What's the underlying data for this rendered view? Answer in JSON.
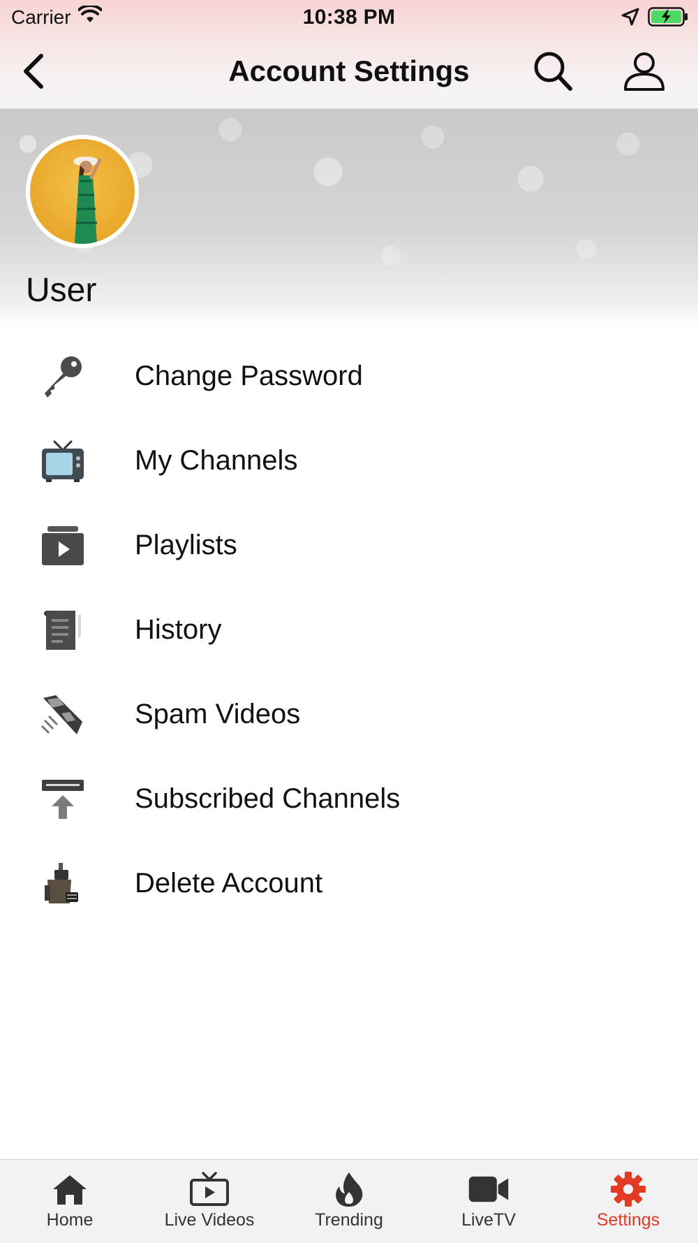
{
  "status_bar": {
    "carrier": "Carrier",
    "time": "10:38 PM"
  },
  "nav": {
    "title": "Account Settings",
    "icons": [
      "chevron-left-icon",
      "search-icon",
      "user-icon"
    ]
  },
  "profile": {
    "username": "User"
  },
  "menu": {
    "items": [
      {
        "label": "Change Password",
        "icon": "key-icon"
      },
      {
        "label": "My Channels",
        "icon": "tv-icon"
      },
      {
        "label": "Playlists",
        "icon": "playlist-icon"
      },
      {
        "label": "History",
        "icon": "history-icon"
      },
      {
        "label": "Spam Videos",
        "icon": "spam-icon"
      },
      {
        "label": "Subscribed Channels",
        "icon": "subscribe-icon"
      },
      {
        "label": "Delete Account",
        "icon": "delete-account-icon"
      }
    ]
  },
  "tabs": {
    "items": [
      {
        "label": "Home",
        "icon": "home-icon"
      },
      {
        "label": "Live Videos",
        "icon": "live-videos-icon"
      },
      {
        "label": "Trending",
        "icon": "flame-icon"
      },
      {
        "label": "LiveTV",
        "icon": "video-camera-icon"
      },
      {
        "label": "Settings",
        "icon": "gear-icon"
      }
    ],
    "active": "Settings"
  },
  "colors": {
    "accent": "#e23a25",
    "status_bar_bg": "#f8d3d3",
    "tab_bar_bg": "#f2f2f2",
    "battery": "#4cd964"
  }
}
